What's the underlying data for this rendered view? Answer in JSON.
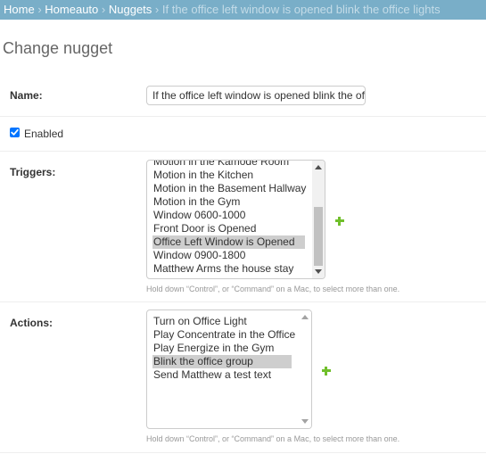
{
  "breadcrumbs": {
    "home": "Home",
    "app": "Homeauto",
    "model": "Nuggets",
    "current": "If the office left window is opened blink the office lights",
    "separator": "›"
  },
  "page_title": "Change nugget",
  "name_field": {
    "label": "Name:",
    "value": "If the office left window is opened blink the office lights"
  },
  "enabled": {
    "label": "Enabled",
    "checked": true
  },
  "triggers": {
    "label": "Triggers:",
    "options": [
      "Motion in the Kamode Room",
      "Motion in the Kitchen",
      "Motion in the Basement Hallway",
      "Motion in the Gym",
      "Window 0600-1000",
      "Front Door is Opened",
      "Office Left Window is Opened",
      "Window 0900-1800",
      "Matthew Arms the house stay"
    ],
    "selected": "Office Left Window is Opened",
    "help": "Hold down “Control”, or “Command” on a Mac, to select more than one."
  },
  "actions": {
    "label": "Actions:",
    "options": [
      "Turn on Office Light",
      "Play Concentrate in the Office",
      "Play Energize in the Gym",
      "Blink the office group",
      "Send Matthew a test text"
    ],
    "selected": "Blink the office group",
    "help": "Hold down “Control”, or “Command” on a Mac, to select more than one."
  },
  "icons": {
    "add": "plus-icon",
    "check": "checkmark-icon"
  },
  "colors": {
    "header": "#79aec8",
    "accent": "#70bf2b",
    "selected": "#cecece",
    "checkbox": "#0075ff"
  }
}
